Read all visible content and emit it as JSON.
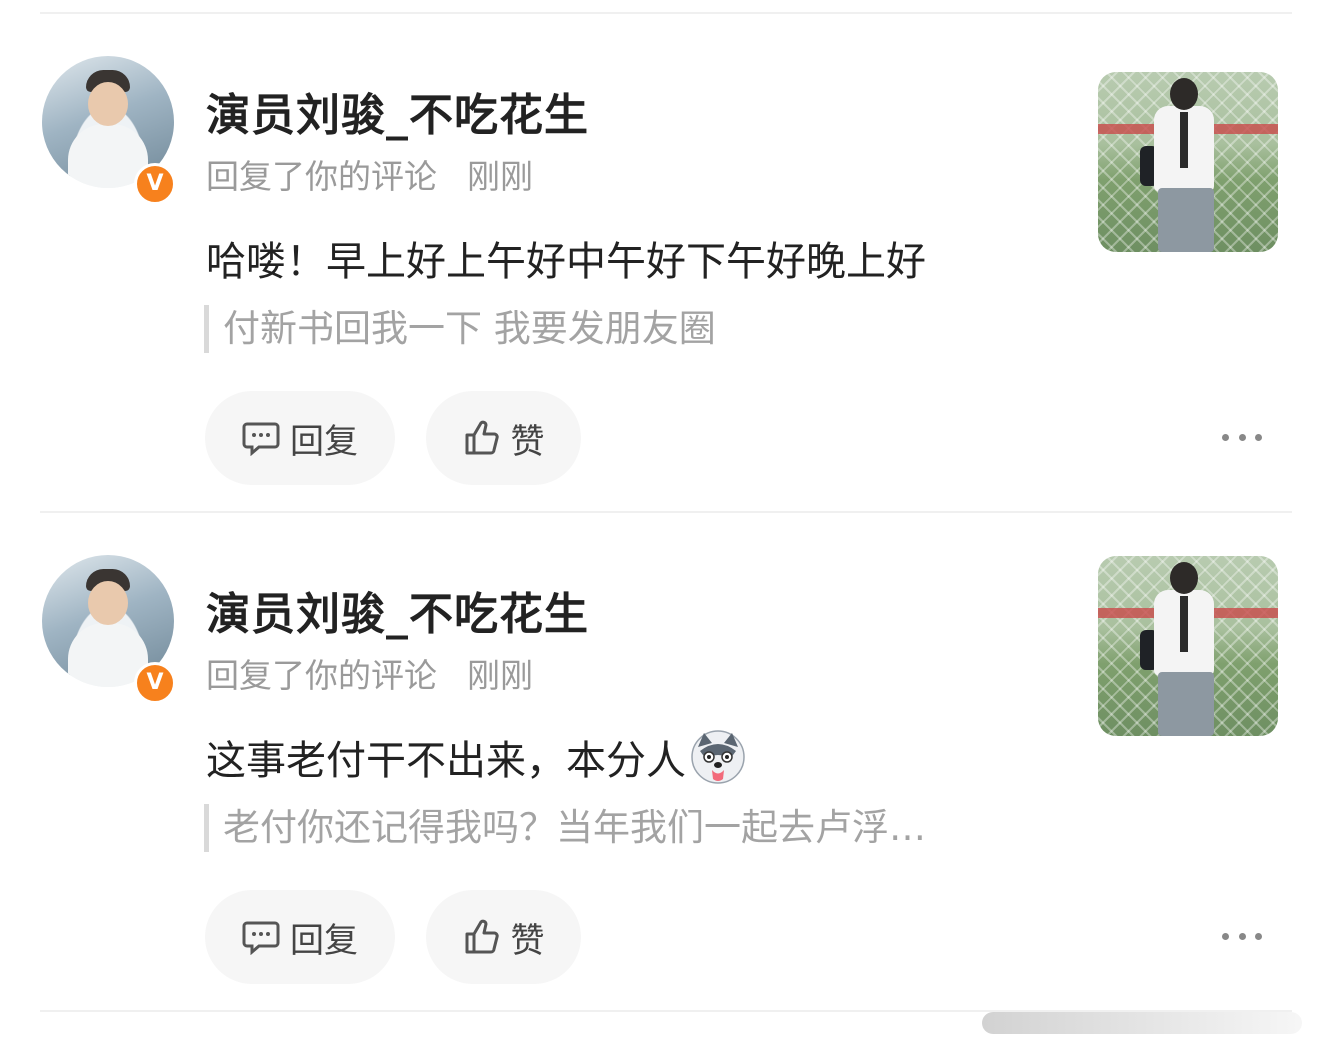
{
  "comments": [
    {
      "username": "演员刘骏_不吃花生",
      "action": "回复了你的评论",
      "time": "刚刚",
      "reply_text": "哈喽！早上好上午好中午好下午好晚上好",
      "quoted_text": "付新书回我一下 我要发朋友圈",
      "reply_label": "回复",
      "like_label": "赞",
      "verified_badge": "V"
    },
    {
      "username": "演员刘骏_不吃花生",
      "action": "回复了你的评论",
      "time": "刚刚",
      "reply_text": "这事老付干不出来，本分人",
      "reply_emoji": "husky-emoji",
      "quoted_text": "老付你还记得我吗？当年我们一起去卢浮…",
      "reply_label": "回复",
      "like_label": "赞",
      "verified_badge": "V"
    }
  ],
  "colors": {
    "badge": "#f7811d",
    "button_bg": "#f6f6f6",
    "meta_text": "#9a9a9a"
  }
}
